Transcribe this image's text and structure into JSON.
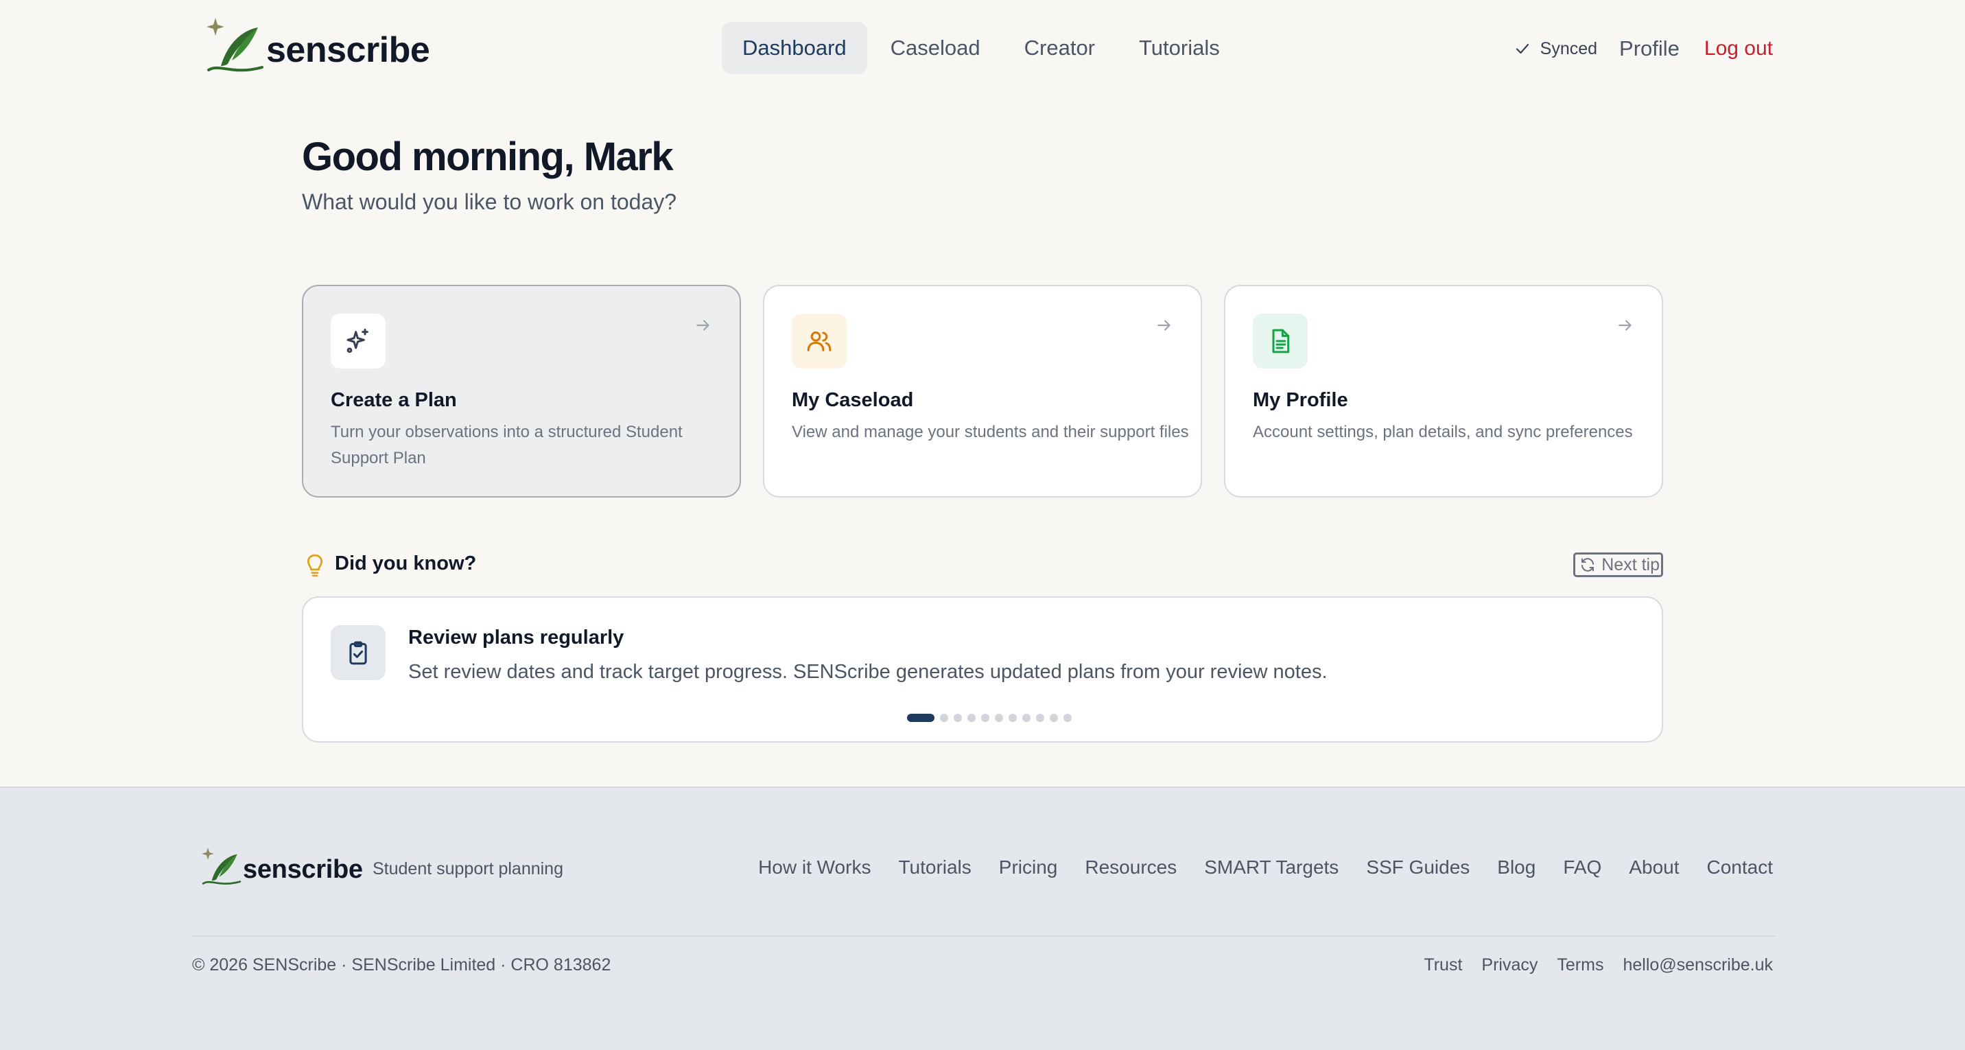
{
  "header": {
    "logo_text": "senscribe",
    "nav": [
      {
        "label": "Dashboard",
        "active": true
      },
      {
        "label": "Caseload",
        "active": false
      },
      {
        "label": "Creator",
        "active": false
      },
      {
        "label": "Tutorials",
        "active": false
      }
    ],
    "sync_status": "Synced",
    "profile_label": "Profile",
    "logout_label": "Log out"
  },
  "main": {
    "greeting": "Good morning, Mark",
    "subtitle": "What would you like to work on today?",
    "cards": [
      {
        "title": "Create a Plan",
        "description": "Turn your observations into a structured Student Support Plan",
        "icon": "sparkles-icon",
        "icon_bg": "#ffffff",
        "icon_color": "#374151"
      },
      {
        "title": "My Caseload",
        "description": "View and manage your students and their support files",
        "icon": "users-icon",
        "icon_bg": "#fdf4e3",
        "icon_color": "#d97706"
      },
      {
        "title": "My Profile",
        "description": "Account settings, plan details, and sync preferences",
        "icon": "document-icon",
        "icon_bg": "#e6f6ee",
        "icon_color": "#16a34a"
      }
    ]
  },
  "tip": {
    "heading": "Did you know?",
    "next_label": "Next tip",
    "title": "Review plans regularly",
    "text": "Set review dates and track target progress. SENScribe generates updated plans from your review notes.",
    "total_tips": 11,
    "current_tip": 1
  },
  "footer": {
    "logo_text": "senscribe",
    "tagline": "Student support planning",
    "nav": [
      "How it Works",
      "Tutorials",
      "Pricing",
      "Resources",
      "SMART Targets",
      "SSF Guides",
      "Blog",
      "FAQ",
      "About",
      "Contact"
    ],
    "copyright": "© 2026 SENScribe · SENScribe Limited · CRO 813862",
    "legal": [
      "Trust",
      "Privacy",
      "Terms",
      "hello@senscribe.uk"
    ]
  },
  "colors": {
    "page_bg": "#f8f7f4",
    "accent_navy": "#1e3a5f",
    "logout_red": "#c81e2b",
    "logo_green": "#2f6b2a",
    "footer_bg": "#e4e8ec"
  }
}
